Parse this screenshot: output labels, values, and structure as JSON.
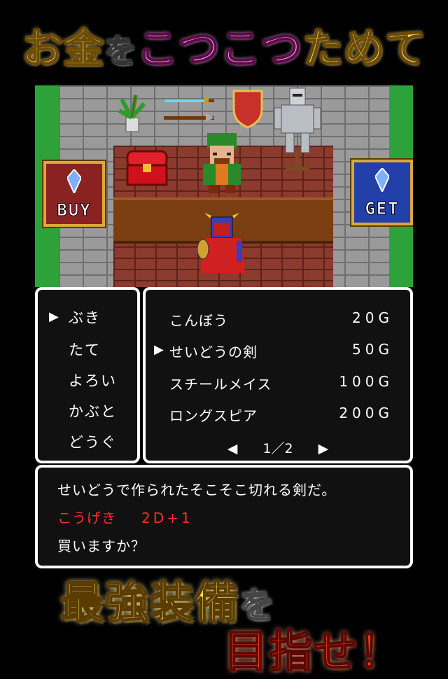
{
  "header": {
    "title_part1": "お金",
    "title_part2": "を",
    "title_part3": "こつこつ",
    "title_part4": "ためて"
  },
  "scene": {
    "buy_label": "BUY",
    "get_label": "GET"
  },
  "categories": {
    "cursor": "▶",
    "items": [
      "ぶき",
      "たて",
      "よろい",
      "かぶと",
      "どうぐ"
    ],
    "selected_index": 0
  },
  "shop_list": {
    "cursor": "▶",
    "items": [
      {
        "name": "こんぼう",
        "price": "20G"
      },
      {
        "name": "せいどうの剣",
        "price": "50G"
      },
      {
        "name": "スチールメイス",
        "price": "100G"
      },
      {
        "name": "ロングスピア",
        "price": "200G"
      }
    ],
    "selected_index": 1,
    "pager": {
      "prev": "◀",
      "label": "1／2",
      "next": "▶"
    }
  },
  "description": {
    "text": "せいどうで作られたそこそこ切れる剣だ。",
    "attack_label": "こうげき",
    "attack_value": "2D+1",
    "prompt": "買いますか？"
  },
  "footer": {
    "slogan_part1": "最強装備",
    "slogan_part2": "を",
    "slogan_part3": "目指せ！"
  },
  "colors": {
    "accent_gold": "#ffdc5a",
    "accent_pink": "#ff9ae0",
    "attack_red": "#ff2a2a",
    "buy_bg": "#8a2222",
    "get_bg": "#233fa8"
  }
}
